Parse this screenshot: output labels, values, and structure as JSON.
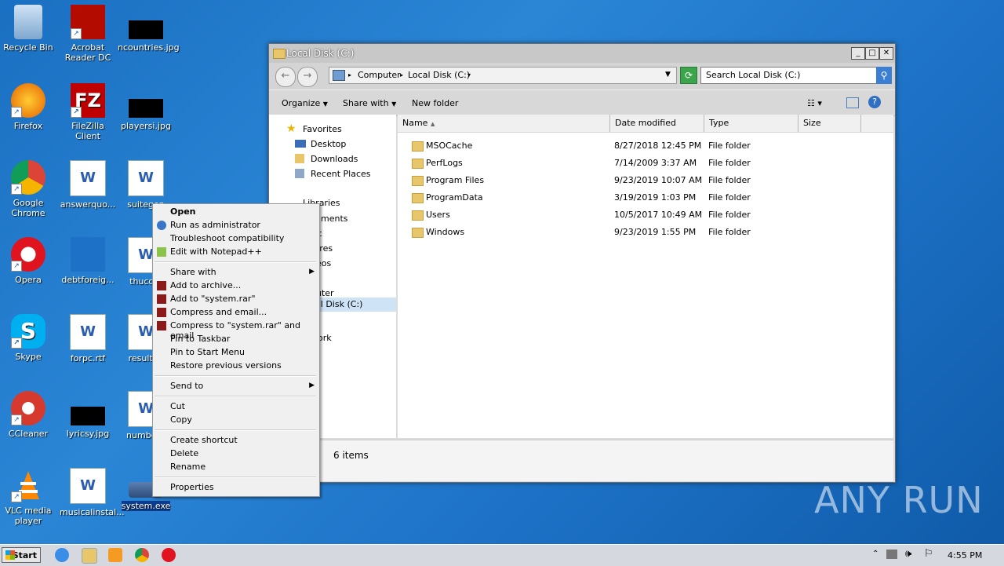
{
  "desktop": {
    "icons": [
      {
        "label": "Recycle Bin"
      },
      {
        "label": "Acrobat\nReader DC"
      },
      {
        "label": "ncountries.jpg"
      },
      {
        "label": "Firefox"
      },
      {
        "label": "FileZilla Client"
      },
      {
        "label": "playersi.jpg"
      },
      {
        "label": "Google\nChrome"
      },
      {
        "label": "answerquo..."
      },
      {
        "label": "suitegen"
      },
      {
        "label": "Opera"
      },
      {
        "label": "debtforeig..."
      },
      {
        "label": "thucom"
      },
      {
        "label": "Skype"
      },
      {
        "label": "forpc.rtf"
      },
      {
        "label": "resultan"
      },
      {
        "label": "CCleaner"
      },
      {
        "label": "lyricsy.jpg"
      },
      {
        "label": "numberp"
      },
      {
        "label": "VLC media\nplayer"
      },
      {
        "label": "musicalinstal..."
      },
      {
        "label": "system.exe"
      }
    ]
  },
  "explorer": {
    "title": "Local Disk (C:)",
    "address": {
      "part1": "Computer",
      "part2": "Local Disk (C:)"
    },
    "search_placeholder": "Search Local Disk (C:)",
    "toolbar": {
      "organize": "Organize",
      "share_with": "Share with",
      "new_folder": "New folder"
    },
    "nav": {
      "favorites": "Favorites",
      "desktop": "Desktop",
      "downloads": "Downloads",
      "recent": "Recent Places",
      "libraries": "Libraries",
      "documents": "cuments",
      "music": "sic",
      "pictures": "tures",
      "videos": "deos",
      "computer": "puter",
      "local_disk": "cal Disk (C:)",
      "network": "work"
    },
    "columns": {
      "name": "Name",
      "date": "Date modified",
      "type": "Type",
      "size": "Size"
    },
    "files": [
      {
        "name": "MSOCache",
        "date": "8/27/2018 12:45 PM",
        "type": "File folder"
      },
      {
        "name": "PerfLogs",
        "date": "7/14/2009 3:37 AM",
        "type": "File folder"
      },
      {
        "name": "Program Files",
        "date": "9/23/2019 10:07 AM",
        "type": "File folder"
      },
      {
        "name": "ProgramData",
        "date": "3/19/2019 1:03 PM",
        "type": "File folder"
      },
      {
        "name": "Users",
        "date": "10/5/2017 10:49 AM",
        "type": "File folder"
      },
      {
        "name": "Windows",
        "date": "9/23/2019 1:55 PM",
        "type": "File folder"
      }
    ],
    "status": "6 items"
  },
  "context_menu": {
    "open": "Open",
    "run_admin": "Run as administrator",
    "troubleshoot": "Troubleshoot compatibility",
    "edit_npp": "Edit with Notepad++",
    "share_with": "Share with",
    "add_archive": "Add to archive...",
    "add_rar": "Add to \"system.rar\"",
    "compress_email": "Compress and email...",
    "compress_rar_email": "Compress to \"system.rar\" and email",
    "pin_taskbar": "Pin to Taskbar",
    "pin_start": "Pin to Start Menu",
    "restore": "Restore previous versions",
    "send_to": "Send to",
    "cut": "Cut",
    "copy": "Copy",
    "create_shortcut": "Create shortcut",
    "delete": "Delete",
    "rename": "Rename",
    "properties": "Properties"
  },
  "taskbar": {
    "start": "Start",
    "clock": "4:55 PM"
  },
  "watermark": "ANY RUN"
}
